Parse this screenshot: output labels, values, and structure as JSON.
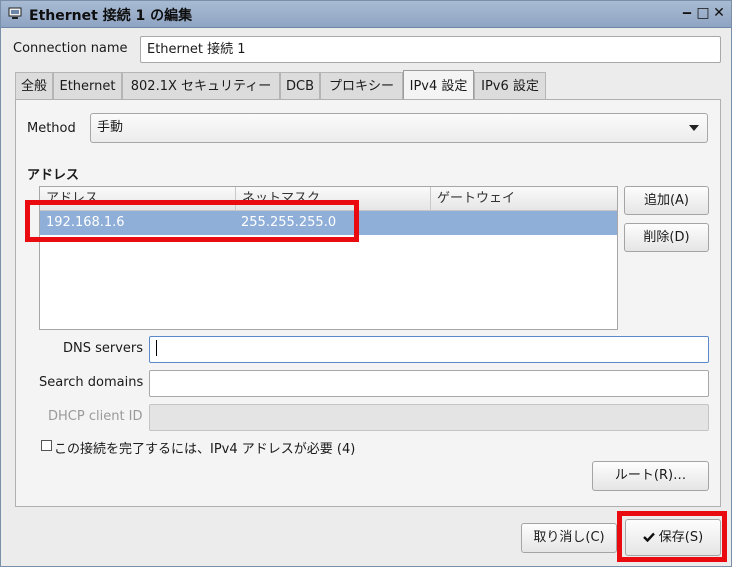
{
  "window": {
    "title": "Ethernet 接続 1 の編集",
    "buttons": {
      "minimize": "‒",
      "maximize": "□",
      "close": "✕"
    }
  },
  "connection_name": {
    "label": "Connection name",
    "value": "Ethernet 接続 1"
  },
  "tabs": [
    {
      "label": "全般",
      "active": false
    },
    {
      "label": "Ethernet",
      "active": false
    },
    {
      "label": "802.1X セキュリティー",
      "active": false
    },
    {
      "label": "DCB",
      "active": false
    },
    {
      "label": "プロキシー",
      "active": false
    },
    {
      "label": "IPv4 設定",
      "active": true
    },
    {
      "label": "IPv6 設定",
      "active": false
    }
  ],
  "ipv4": {
    "method": {
      "label": "Method",
      "value": "手動"
    },
    "addresses": {
      "title": "アドレス",
      "columns": [
        "アドレス",
        "ネットマスク",
        "ゲートウェイ"
      ],
      "rows": [
        {
          "address": "192.168.1.6",
          "netmask": "255.255.255.0",
          "gateway": ""
        }
      ],
      "add_button": "追加(A)",
      "delete_button": "削除(D)"
    },
    "dns_servers": {
      "label": "DNS servers",
      "value": ""
    },
    "search_domains": {
      "label": "Search domains",
      "value": ""
    },
    "dhcp_client_id": {
      "label": "DHCP client ID",
      "value": ""
    },
    "require_checkbox": {
      "label": "この接続を完了するには、IPv4 アドレスが必要 (4)",
      "checked": false
    },
    "routes_button": "ルート(R)…"
  },
  "footer": {
    "cancel_button": "取り消し(C)",
    "save_button": "保存(S)",
    "save_icon": "checkmark-icon"
  },
  "colors": {
    "highlight": "#ea0b10",
    "selection": "#8fafd8",
    "titlebar": "#9db1cc"
  }
}
